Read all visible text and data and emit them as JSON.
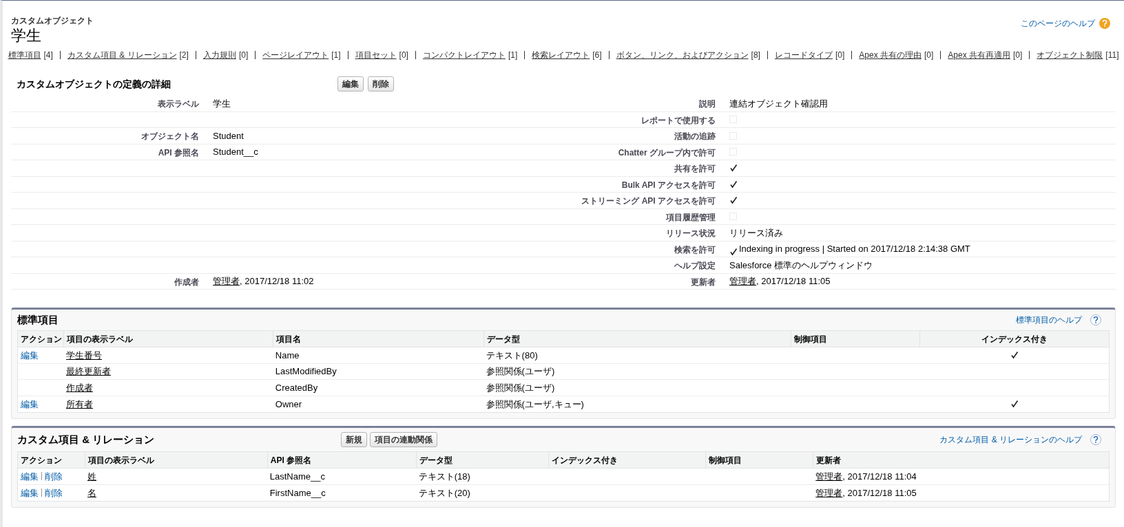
{
  "header": {
    "subtitle": "カスタムオブジェクト",
    "title": "学生",
    "help_link": "このページのヘルプ"
  },
  "nav": [
    {
      "label": "標準項目",
      "count": "[4]"
    },
    {
      "label": "カスタム項目 & リレーション",
      "count": "[2]"
    },
    {
      "label": "入力規則",
      "count": "[0]"
    },
    {
      "label": "ページレイアウト",
      "count": "[1]"
    },
    {
      "label": "項目セット",
      "count": "[0]"
    },
    {
      "label": "コンパクトレイアウト",
      "count": "[1]"
    },
    {
      "label": "検索レイアウト",
      "count": "[6]"
    },
    {
      "label": "ボタン、リンク、およびアクション",
      "count": "[8]"
    },
    {
      "label": "レコードタイプ",
      "count": "[0]"
    },
    {
      "label": "Apex 共有の理由",
      "count": "[0]"
    },
    {
      "label": "Apex 共有再適用",
      "count": "[0]"
    },
    {
      "label": "オブジェクト制限",
      "count": "[11]"
    }
  ],
  "detail": {
    "title": "カスタムオブジェクトの定義の詳細",
    "buttons": [
      "編集",
      "削除"
    ],
    "rows": [
      {
        "left": {
          "label": "表示ラベル",
          "kind": "text",
          "value": "学生"
        },
        "right": {
          "label": "説明",
          "kind": "text",
          "value": "連結オブジェクト確認用"
        }
      },
      {
        "right": {
          "label": "レポートで使用する",
          "kind": "checkbox",
          "checked": false
        }
      },
      {
        "left": {
          "label": "オブジェクト名",
          "kind": "text",
          "value": "Student"
        },
        "right": {
          "label": "活動の追跡",
          "kind": "checkbox",
          "checked": false
        }
      },
      {
        "left": {
          "label": "API 参照名",
          "kind": "text",
          "value": "Student__c"
        },
        "right": {
          "label": "Chatter グループ内で許可",
          "kind": "checkbox",
          "checked": false
        }
      },
      {
        "right": {
          "label": "共有を許可",
          "kind": "checkbox",
          "checked": true
        }
      },
      {
        "right": {
          "label": "Bulk API アクセスを許可",
          "kind": "checkbox",
          "checked": true
        }
      },
      {
        "right": {
          "label": "ストリーミング API アクセスを許可",
          "kind": "checkbox",
          "checked": true
        }
      },
      {
        "right": {
          "label": "項目履歴管理",
          "kind": "checkbox",
          "checked": false
        }
      },
      {
        "right": {
          "label": "リリース状況",
          "kind": "text",
          "value": "リリース済み"
        }
      },
      {
        "right": {
          "label": "検索を許可",
          "kind": "checkbox_text",
          "checked": true,
          "value": "Indexing in progress | Started on 2017/12/18 2:14:38 GMT"
        }
      },
      {
        "right": {
          "label": "ヘルプ設定",
          "kind": "text",
          "value": "Salesforce 標準のヘルプウィンドウ"
        }
      },
      {
        "left": {
          "label": "作成者",
          "kind": "user",
          "user": "管理者",
          "value": ", 2017/12/18 11:02"
        },
        "right": {
          "label": "更新者",
          "kind": "user",
          "user": "管理者",
          "value": ", 2017/12/18 11:05"
        }
      }
    ]
  },
  "standard_fields": {
    "title": "標準項目",
    "help_link": "標準項目のヘルプ",
    "columns": [
      "アクション",
      "項目の表示ラベル",
      "項目名",
      "データ型",
      "制御項目",
      "インデックス付き"
    ],
    "rows": [
      {
        "action": "編集",
        "label": "学生番号",
        "name": "Name",
        "type": "テキスト(80)",
        "indexed": true
      },
      {
        "label": "最終更新者",
        "name": "LastModifiedBy",
        "type": "参照関係(ユーザ)",
        "indexed": false
      },
      {
        "label": "作成者",
        "name": "CreatedBy",
        "type": "参照関係(ユーザ)",
        "indexed": false
      },
      {
        "action": "編集",
        "label": "所有者",
        "name": "Owner",
        "type": "参照関係(ユーザ,キュー)",
        "indexed": true
      }
    ]
  },
  "custom_fields": {
    "title": "カスタム項目 & リレーション",
    "buttons": [
      "新規",
      "項目の連動関係"
    ],
    "help_link": "カスタム項目 & リレーションのヘルプ",
    "columns": [
      "アクション",
      "項目の表示ラベル",
      "API 参照名",
      "データ型",
      "インデックス付き",
      "制御項目",
      "更新者"
    ],
    "rows": [
      {
        "actions": [
          "編集",
          "削除"
        ],
        "label": "姓",
        "api_name": "LastName__c",
        "type": "テキスト(18)",
        "modified_user": "管理者",
        "modified_date": ", 2017/12/18 11:04"
      },
      {
        "actions": [
          "編集",
          "削除"
        ],
        "label": "名",
        "api_name": "FirstName__c",
        "type": "テキスト(20)",
        "modified_user": "管理者",
        "modified_date": ", 2017/12/18 11:05"
      }
    ]
  }
}
